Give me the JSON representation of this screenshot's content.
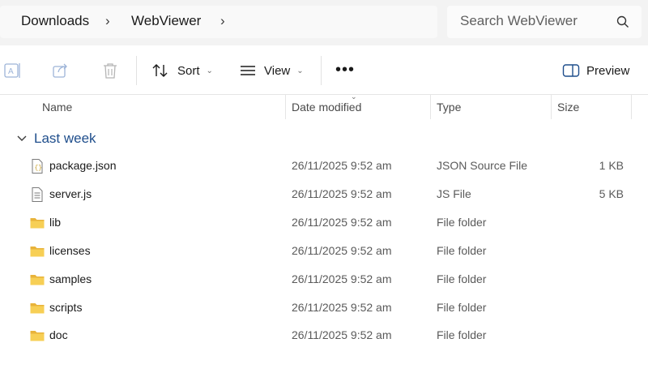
{
  "breadcrumb": {
    "items": [
      "Downloads",
      "WebViewer"
    ]
  },
  "search": {
    "placeholder": "Search WebViewer"
  },
  "toolbar": {
    "sort_label": "Sort",
    "view_label": "View",
    "more_label": "•••",
    "preview_label": "Preview"
  },
  "columns": {
    "name": "Name",
    "date": "Date modified",
    "type": "Type",
    "size": "Size"
  },
  "group": {
    "label": "Last week"
  },
  "files": [
    {
      "name": "package.json",
      "date": "26/11/2025 9:52 am",
      "type": "JSON Source File",
      "size": "1 KB",
      "icon": "json-file-icon"
    },
    {
      "name": "server.js",
      "date": "26/11/2025 9:52 am",
      "type": "JS File",
      "size": "5 KB",
      "icon": "js-file-icon"
    },
    {
      "name": "lib",
      "date": "26/11/2025 9:52 am",
      "type": "File folder",
      "size": "",
      "icon": "folder-icon"
    },
    {
      "name": "licenses",
      "date": "26/11/2025 9:52 am",
      "type": "File folder",
      "size": "",
      "icon": "folder-icon"
    },
    {
      "name": "samples",
      "date": "26/11/2025 9:52 am",
      "type": "File folder",
      "size": "",
      "icon": "folder-icon"
    },
    {
      "name": "scripts",
      "date": "26/11/2025 9:52 am",
      "type": "File folder",
      "size": "",
      "icon": "folder-icon"
    },
    {
      "name": "doc",
      "date": "26/11/2025 9:52 am",
      "type": "File folder",
      "size": "",
      "icon": "folder-icon"
    }
  ],
  "colors": {
    "group_label": "#1f4e8c",
    "folder": "#f4c542",
    "topbar_bg": "#f3f3f3"
  }
}
